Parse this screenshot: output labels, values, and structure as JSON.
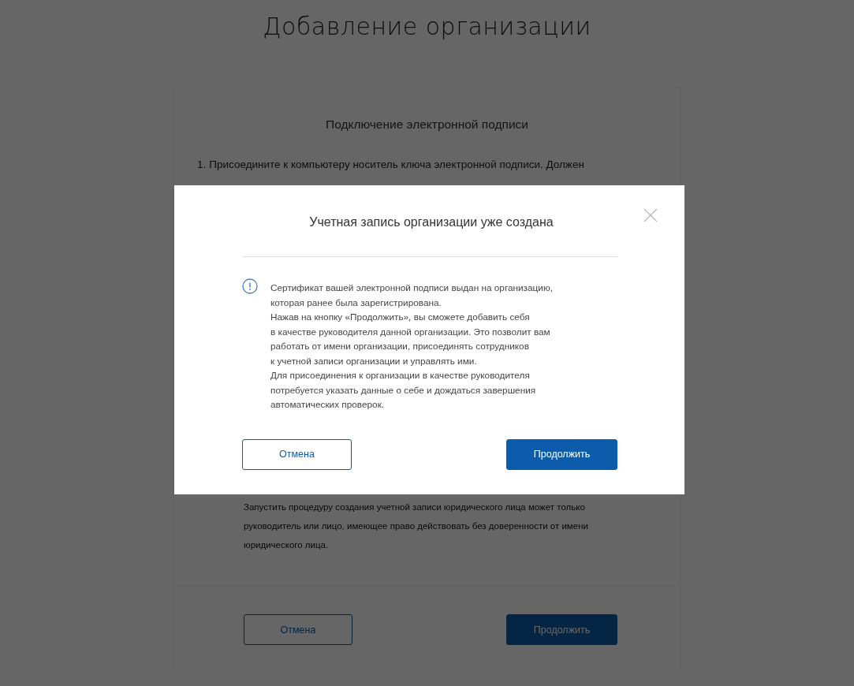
{
  "page": {
    "title": "Добавление организации",
    "card": {
      "heading": "Подключение электронной подписи",
      "steps": [
        {
          "number": "1.",
          "lines": [
            "Присоедините к компьютеру носитель ключа электронной подписи. Должен"
          ]
        }
      ],
      "note": [
        "Запустить процедуру создания учетной записи юридического лица может только",
        "руководитель или лицо, имеющее право действовать без доверенности от имени",
        "юридического лица."
      ],
      "buttons": [
        {
          "label": "Отмена",
          "kind": "secondary"
        },
        {
          "label": "Продолжить",
          "kind": "primary"
        }
      ]
    }
  },
  "dialog": {
    "title": "Учетная запись организации уже создана",
    "paragraphs": [
      [
        "Сертификат вашей электронной подписи выдан на организацию,",
        "которая ранее была зарегистрирована."
      ],
      [
        "Нажав на кнопку «Продолжить», вы сможете добавить себя",
        "в качестве руководителя данной организации. Это позволит вам",
        "работать от имени организации, присоединять сотрудников",
        "к учетной записи организации и управлять ими."
      ],
      [
        "Для присоединения к организации в качестве руководителя",
        "потребуется указать данные о себе и дождаться завершения",
        "автоматических проверок."
      ]
    ],
    "buttons": [
      {
        "label": "Отмена",
        "kind": "secondary"
      },
      {
        "label": "Продолжить",
        "kind": "primary"
      }
    ]
  }
}
